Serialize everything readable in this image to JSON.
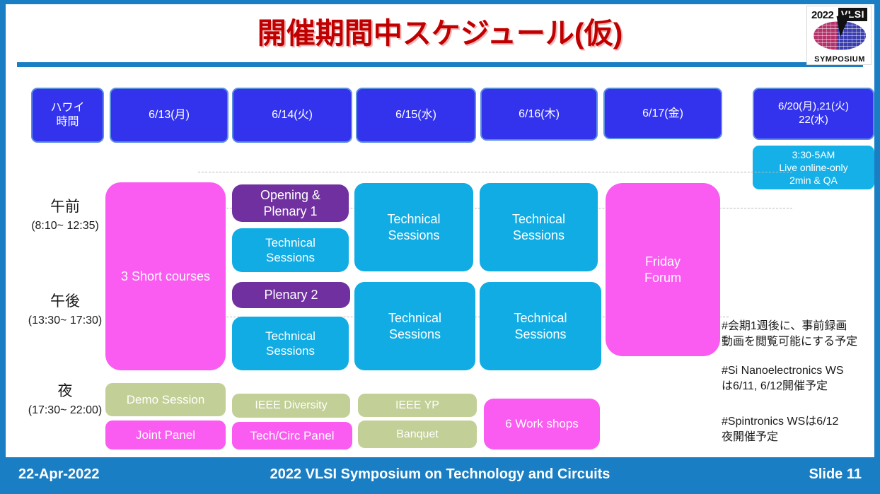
{
  "slide": {
    "title": "開催期間中スケジュール(仮)",
    "accent_blue": "#1a7ec4",
    "title_color": "#c00000"
  },
  "logo": {
    "year": "2022",
    "mark": "VLSI",
    "wordmark": "SYMPOSIUM"
  },
  "day_headers": [
    {
      "label": "ハワイ\n時間"
    },
    {
      "label": "6/13(月)"
    },
    {
      "label": "6/14(火)"
    },
    {
      "label": "6/15(水)"
    },
    {
      "label": "6/16(木)"
    },
    {
      "label": "6/17(金)"
    },
    {
      "label": "6/20(月),21(火)\n22(水)"
    }
  ],
  "live_chip": {
    "label": "3:30-5AM\nLive online-only\n2min & QA",
    "color": "#15b0e8"
  },
  "row_labels": [
    {
      "jp": "午前",
      "time": "(8:10~\n12:35)"
    },
    {
      "jp": "午後",
      "time": "(13:30~\n17:30)"
    },
    {
      "jp": "夜",
      "time": "(17:30~\n22:00)"
    }
  ],
  "sessions": {
    "short_courses": {
      "label": "3 Short courses",
      "color": "#fa5bf0"
    },
    "opening_plenary1": {
      "label": "Opening &\nPlenary 1",
      "color": "#7030a0"
    },
    "tech_tue_am": {
      "label": "Technical\nSessions",
      "color": "#11ace3"
    },
    "tech_wed_am": {
      "label": "Technical\nSessions",
      "color": "#11ace3"
    },
    "tech_thu_am": {
      "label": "Technical\nSessions",
      "color": "#11ace3"
    },
    "plenary2": {
      "label": "Plenary 2",
      "color": "#7030a0"
    },
    "tech_tue_pm": {
      "label": "Technical\nSessions",
      "color": "#11ace3"
    },
    "tech_wed_pm": {
      "label": "Technical\nSessions",
      "color": "#11ace3"
    },
    "tech_thu_pm": {
      "label": "Technical\nSessions",
      "color": "#11ace3"
    },
    "friday_forum": {
      "label": "Friday\nForum",
      "color": "#fa5bf0"
    },
    "demo_session": {
      "label": "Demo Session",
      "color": "#c2cf96"
    },
    "joint_panel": {
      "label": "Joint Panel",
      "color": "#fa5bf0"
    },
    "ieee_diversity": {
      "label": "IEEE Diversity",
      "color": "#c2cf96"
    },
    "tech_circ_panel": {
      "label": "Tech/Circ Panel",
      "color": "#fa5bf0"
    },
    "ieee_yp": {
      "label": "IEEE YP",
      "color": "#c2cf96"
    },
    "banquet": {
      "label": "Banquet",
      "color": "#c2cf96"
    },
    "work_shops": {
      "label": "6 Work shops",
      "color": "#fa5bf0"
    }
  },
  "notes": [
    {
      "text": "#会期1週後に、事前録画\n動画を閲覧可能にする予定"
    },
    {
      "text": "#Si Nanoelectronics WS\nは6/11, 6/12開催予定"
    },
    {
      "text": "#Spintronics WSは6/12\n夜開催予定"
    }
  ],
  "footer": {
    "date": "22-Apr-2022",
    "center": "2022 VLSI Symposium on Technology and Circuits",
    "slide_number": "Slide 11"
  }
}
